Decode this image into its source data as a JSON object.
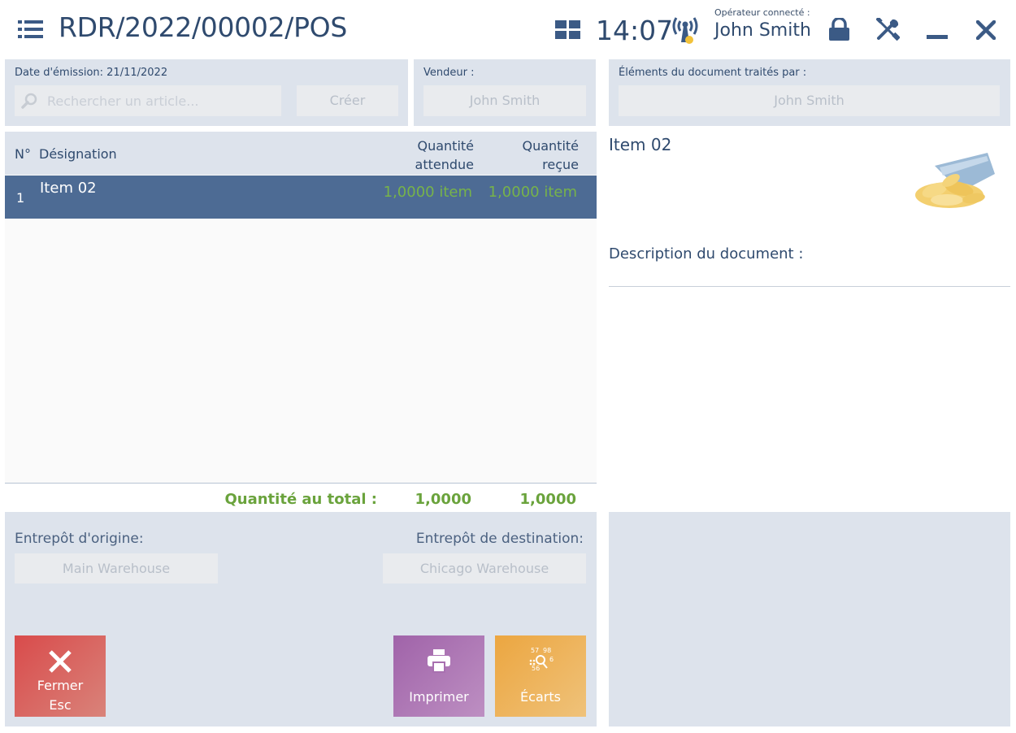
{
  "header": {
    "title": "RDR/2022/00002/POS",
    "clock": "14:07",
    "operator_label": "Opérateur connecté :",
    "operator_name": "John Smith"
  },
  "doc_panel": {
    "issue_date_label": "Date d'émission: 21/11/2022",
    "search_placeholder": "Rechercher un article...",
    "create_label": "Créer"
  },
  "seller_panel": {
    "label": "Vendeur :",
    "value": "John Smith"
  },
  "processed_panel": {
    "label": "Éléments du document traités par :",
    "value": "John Smith"
  },
  "table": {
    "col_no": "N°",
    "col_designation": "Désignation",
    "col_expected_line1": "Quantité",
    "col_expected_line2": "attendue",
    "col_received_line1": "Quantité",
    "col_received_line2": "reçue",
    "rows": [
      {
        "no": "1",
        "name": "Item 02",
        "expected": "1,0000 item",
        "received": "1,0000 item"
      }
    ],
    "total_label": "Quantité au total :",
    "total_expected": "1,0000",
    "total_received": "1,0000"
  },
  "detail": {
    "item_name": "Item 02",
    "description_label": "Description du document :"
  },
  "warehouses": {
    "origin_label": "Entrepôt d'origine:",
    "origin_value": "Main Warehouse",
    "destination_label": "Entrepôt de destination:",
    "destination_value": "Chicago Warehouse"
  },
  "actions": {
    "close_line1": "Fermer",
    "close_line2": "Esc",
    "print": "Imprimer",
    "discrepancies": "Écarts",
    "discrepancies_icon_text": [
      "57",
      "98",
      "6",
      "56"
    ]
  },
  "colors": {
    "accent": "#2f4a6e",
    "selected_row": "#4d6b94",
    "panel": "#dde3ec",
    "close_tile": "#d35a5a",
    "print_tile": "#a870b0",
    "discrepancy_tile": "#eeb254",
    "quantity_green": "#77b34a"
  }
}
